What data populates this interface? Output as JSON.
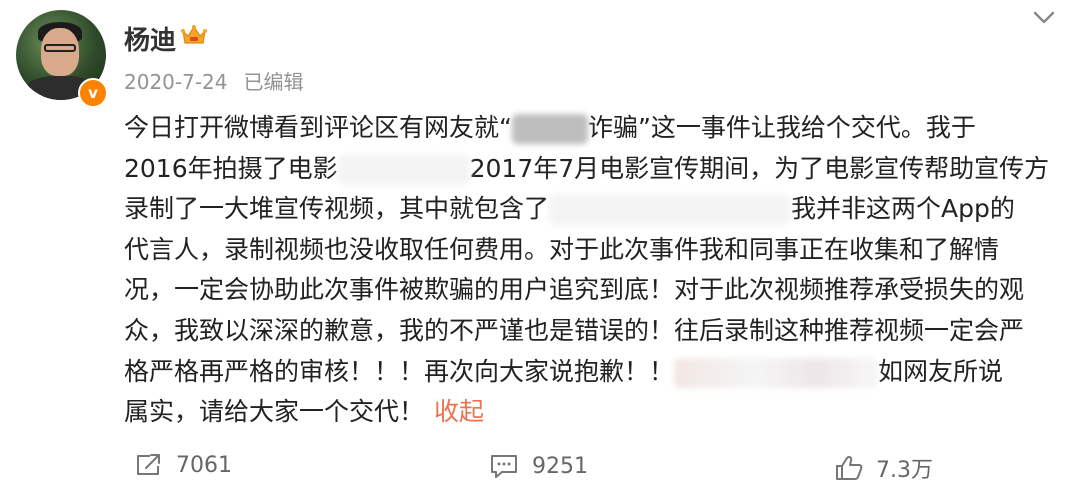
{
  "post": {
    "author": "杨迪",
    "date": "2020-7-24",
    "edited_label": "已编辑",
    "verified_mark": "v",
    "lines": [
      {
        "a": "今日打开微博看到评论区有网友就“",
        "b": "诈骗”这一事件让我给个交代。我于"
      },
      {
        "a": "2016年拍摄了电影",
        "b": "2017年7月电影宣传期间，为了电影宣传帮助宣传方"
      },
      {
        "a": "录制了一大堆宣传视频，其中就包含了",
        "b": "我并非这两个App的"
      },
      {
        "a": "代言人，录制视频也没收取任何费用。对于此次事件我和同事正在收集和了解情"
      },
      {
        "a": "况，一定会协助此次事件被欺骗的用户追究到底！对于此次视频推荐承受损失的观"
      },
      {
        "a": "众，我致以深深的歉意，我的不严谨也是错误的！往后录制这种推荐视频一定会严"
      },
      {
        "a": "格严格再严格的审核！！！再次向大家说抱歉！！",
        "b": "如网友所说"
      },
      {
        "a": "属实，请给大家一个交代！",
        "collapse": "收起"
      }
    ]
  },
  "actions": {
    "repost_count": "7061",
    "comment_count": "9251",
    "like_count": "7.3万"
  },
  "icons": {
    "crown": "crown-badge-icon",
    "menu": "chevron-down-icon",
    "repost": "repost-icon",
    "comment": "comment-icon",
    "like": "thumbs-up-icon"
  },
  "colors": {
    "accent": "#eb7350",
    "verified": "#ff8200",
    "meta": "#939393"
  }
}
